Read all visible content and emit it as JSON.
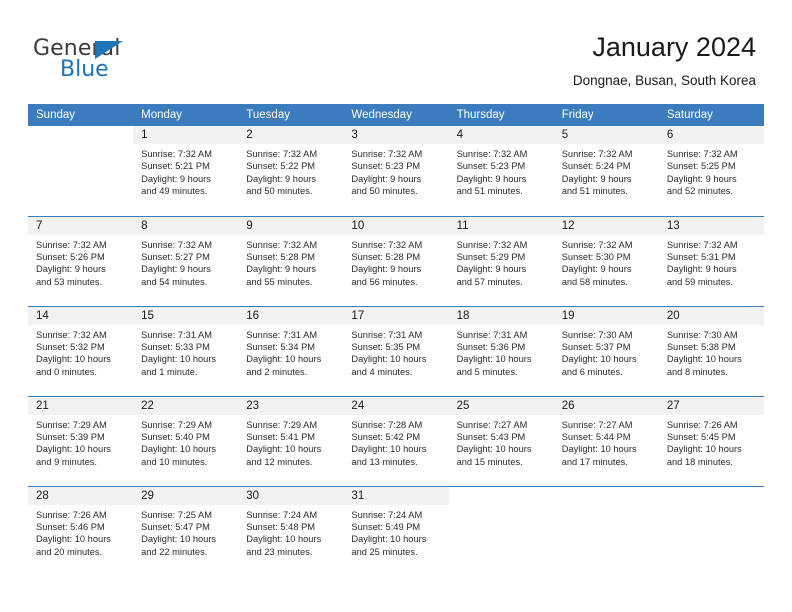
{
  "brand": {
    "line1": "General",
    "line2": "Blue",
    "triangle_icon": "brand-triangle-icon",
    "colors": {
      "general": "#3b3b3b",
      "blue": "#1f73b7"
    }
  },
  "header": {
    "title": "January 2024",
    "subtitle": "Dongnae, Busan, South Korea"
  },
  "colors": {
    "header_row_bg": "#3a7cbe",
    "header_row_text": "#ffffff",
    "daynum_bg": "#f2f2f2",
    "row_separator": "#3a7cbe",
    "body_text": "#2b2b2b"
  },
  "calendar": {
    "weekday_headers": [
      "Sunday",
      "Monday",
      "Tuesday",
      "Wednesday",
      "Thursday",
      "Friday",
      "Saturday"
    ],
    "weeks": [
      [
        {
          "day": ""
        },
        {
          "day": "1",
          "sunrise": "Sunrise: 7:32 AM",
          "sunset": "Sunset: 5:21 PM",
          "daylight_1": "Daylight: 9 hours",
          "daylight_2": "and 49 minutes."
        },
        {
          "day": "2",
          "sunrise": "Sunrise: 7:32 AM",
          "sunset": "Sunset: 5:22 PM",
          "daylight_1": "Daylight: 9 hours",
          "daylight_2": "and 50 minutes."
        },
        {
          "day": "3",
          "sunrise": "Sunrise: 7:32 AM",
          "sunset": "Sunset: 5:23 PM",
          "daylight_1": "Daylight: 9 hours",
          "daylight_2": "and 50 minutes."
        },
        {
          "day": "4",
          "sunrise": "Sunrise: 7:32 AM",
          "sunset": "Sunset: 5:23 PM",
          "daylight_1": "Daylight: 9 hours",
          "daylight_2": "and 51 minutes."
        },
        {
          "day": "5",
          "sunrise": "Sunrise: 7:32 AM",
          "sunset": "Sunset: 5:24 PM",
          "daylight_1": "Daylight: 9 hours",
          "daylight_2": "and 51 minutes."
        },
        {
          "day": "6",
          "sunrise": "Sunrise: 7:32 AM",
          "sunset": "Sunset: 5:25 PM",
          "daylight_1": "Daylight: 9 hours",
          "daylight_2": "and 52 minutes."
        }
      ],
      [
        {
          "day": "7",
          "sunrise": "Sunrise: 7:32 AM",
          "sunset": "Sunset: 5:26 PM",
          "daylight_1": "Daylight: 9 hours",
          "daylight_2": "and 53 minutes."
        },
        {
          "day": "8",
          "sunrise": "Sunrise: 7:32 AM",
          "sunset": "Sunset: 5:27 PM",
          "daylight_1": "Daylight: 9 hours",
          "daylight_2": "and 54 minutes."
        },
        {
          "day": "9",
          "sunrise": "Sunrise: 7:32 AM",
          "sunset": "Sunset: 5:28 PM",
          "daylight_1": "Daylight: 9 hours",
          "daylight_2": "and 55 minutes."
        },
        {
          "day": "10",
          "sunrise": "Sunrise: 7:32 AM",
          "sunset": "Sunset: 5:28 PM",
          "daylight_1": "Daylight: 9 hours",
          "daylight_2": "and 56 minutes."
        },
        {
          "day": "11",
          "sunrise": "Sunrise: 7:32 AM",
          "sunset": "Sunset: 5:29 PM",
          "daylight_1": "Daylight: 9 hours",
          "daylight_2": "and 57 minutes."
        },
        {
          "day": "12",
          "sunrise": "Sunrise: 7:32 AM",
          "sunset": "Sunset: 5:30 PM",
          "daylight_1": "Daylight: 9 hours",
          "daylight_2": "and 58 minutes."
        },
        {
          "day": "13",
          "sunrise": "Sunrise: 7:32 AM",
          "sunset": "Sunset: 5:31 PM",
          "daylight_1": "Daylight: 9 hours",
          "daylight_2": "and 59 minutes."
        }
      ],
      [
        {
          "day": "14",
          "sunrise": "Sunrise: 7:32 AM",
          "sunset": "Sunset: 5:32 PM",
          "daylight_1": "Daylight: 10 hours",
          "daylight_2": "and 0 minutes."
        },
        {
          "day": "15",
          "sunrise": "Sunrise: 7:31 AM",
          "sunset": "Sunset: 5:33 PM",
          "daylight_1": "Daylight: 10 hours",
          "daylight_2": "and 1 minute."
        },
        {
          "day": "16",
          "sunrise": "Sunrise: 7:31 AM",
          "sunset": "Sunset: 5:34 PM",
          "daylight_1": "Daylight: 10 hours",
          "daylight_2": "and 2 minutes."
        },
        {
          "day": "17",
          "sunrise": "Sunrise: 7:31 AM",
          "sunset": "Sunset: 5:35 PM",
          "daylight_1": "Daylight: 10 hours",
          "daylight_2": "and 4 minutes."
        },
        {
          "day": "18",
          "sunrise": "Sunrise: 7:31 AM",
          "sunset": "Sunset: 5:36 PM",
          "daylight_1": "Daylight: 10 hours",
          "daylight_2": "and 5 minutes."
        },
        {
          "day": "19",
          "sunrise": "Sunrise: 7:30 AM",
          "sunset": "Sunset: 5:37 PM",
          "daylight_1": "Daylight: 10 hours",
          "daylight_2": "and 6 minutes."
        },
        {
          "day": "20",
          "sunrise": "Sunrise: 7:30 AM",
          "sunset": "Sunset: 5:38 PM",
          "daylight_1": "Daylight: 10 hours",
          "daylight_2": "and 8 minutes."
        }
      ],
      [
        {
          "day": "21",
          "sunrise": "Sunrise: 7:29 AM",
          "sunset": "Sunset: 5:39 PM",
          "daylight_1": "Daylight: 10 hours",
          "daylight_2": "and 9 minutes."
        },
        {
          "day": "22",
          "sunrise": "Sunrise: 7:29 AM",
          "sunset": "Sunset: 5:40 PM",
          "daylight_1": "Daylight: 10 hours",
          "daylight_2": "and 10 minutes."
        },
        {
          "day": "23",
          "sunrise": "Sunrise: 7:29 AM",
          "sunset": "Sunset: 5:41 PM",
          "daylight_1": "Daylight: 10 hours",
          "daylight_2": "and 12 minutes."
        },
        {
          "day": "24",
          "sunrise": "Sunrise: 7:28 AM",
          "sunset": "Sunset: 5:42 PM",
          "daylight_1": "Daylight: 10 hours",
          "daylight_2": "and 13 minutes."
        },
        {
          "day": "25",
          "sunrise": "Sunrise: 7:27 AM",
          "sunset": "Sunset: 5:43 PM",
          "daylight_1": "Daylight: 10 hours",
          "daylight_2": "and 15 minutes."
        },
        {
          "day": "26",
          "sunrise": "Sunrise: 7:27 AM",
          "sunset": "Sunset: 5:44 PM",
          "daylight_1": "Daylight: 10 hours",
          "daylight_2": "and 17 minutes."
        },
        {
          "day": "27",
          "sunrise": "Sunrise: 7:26 AM",
          "sunset": "Sunset: 5:45 PM",
          "daylight_1": "Daylight: 10 hours",
          "daylight_2": "and 18 minutes."
        }
      ],
      [
        {
          "day": "28",
          "sunrise": "Sunrise: 7:26 AM",
          "sunset": "Sunset: 5:46 PM",
          "daylight_1": "Daylight: 10 hours",
          "daylight_2": "and 20 minutes."
        },
        {
          "day": "29",
          "sunrise": "Sunrise: 7:25 AM",
          "sunset": "Sunset: 5:47 PM",
          "daylight_1": "Daylight: 10 hours",
          "daylight_2": "and 22 minutes."
        },
        {
          "day": "30",
          "sunrise": "Sunrise: 7:24 AM",
          "sunset": "Sunset: 5:48 PM",
          "daylight_1": "Daylight: 10 hours",
          "daylight_2": "and 23 minutes."
        },
        {
          "day": "31",
          "sunrise": "Sunrise: 7:24 AM",
          "sunset": "Sunset: 5:49 PM",
          "daylight_1": "Daylight: 10 hours",
          "daylight_2": "and 25 minutes."
        },
        {
          "day": ""
        },
        {
          "day": ""
        },
        {
          "day": ""
        }
      ]
    ]
  }
}
